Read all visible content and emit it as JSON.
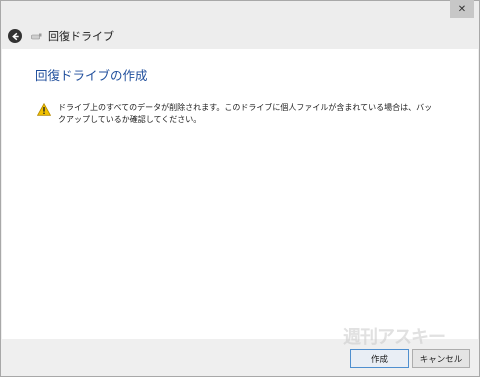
{
  "window": {
    "title": "回復ドライブ",
    "close_glyph": "✕"
  },
  "main": {
    "heading": "回復ドライブの作成",
    "warning_text": "ドライブ上のすべてのデータが削除されます。このドライブに個人ファイルが含まれている場合は、バックアップしているか確認してください。"
  },
  "footer": {
    "create_label": "作成",
    "cancel_label": "キャンセル"
  },
  "watermark": {
    "text": "週刊アスキー"
  },
  "colors": {
    "heading": "#1f4e9c",
    "warning": "#f2c200"
  },
  "icons": {
    "back": "back-arrow-icon",
    "drive": "drive-icon",
    "warning": "warning-icon",
    "close": "close-icon"
  }
}
